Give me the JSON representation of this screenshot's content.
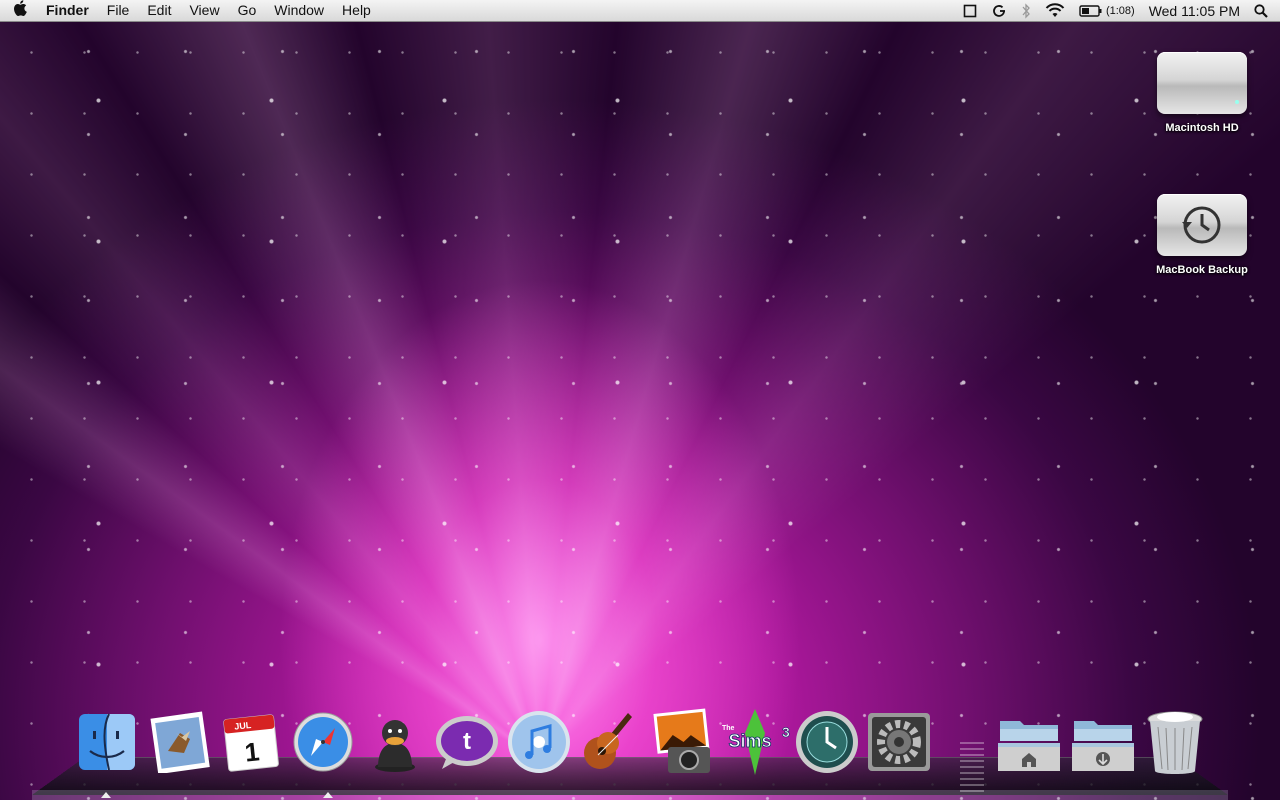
{
  "menubar": {
    "apple_icon": "apple-icon",
    "app_name": "Finder",
    "menus": [
      "File",
      "Edit",
      "View",
      "Go",
      "Window",
      "Help"
    ],
    "status": {
      "battery_time": "(1:08)",
      "clock": "Wed 11:05 PM",
      "icons": [
        "display-icon",
        "sync-icon",
        "bluetooth-icon",
        "wifi-icon",
        "battery-icon",
        "spotlight-icon"
      ]
    }
  },
  "desktop": {
    "icons": [
      {
        "label": "Macintosh HD",
        "icon": "hard-drive-icon"
      },
      {
        "label": "MacBook Backup",
        "icon": "time-machine-drive-icon"
      }
    ]
  },
  "dock": {
    "items": [
      "finder-icon",
      "mail-icon",
      "ical-icon",
      "safari-icon",
      "adium-icon",
      "twitter-icon",
      "itunes-icon",
      "garageband-icon",
      "iphoto-icon",
      "sims3-icon",
      "time-machine-icon",
      "system-preferences-icon",
      "applications-folder-icon",
      "downloads-folder-icon",
      "trash-icon"
    ],
    "calendar": {
      "month": "JUL",
      "day": "1"
    },
    "sims_label": "Sims",
    "sims_small": "The",
    "sims_num": "3",
    "colors": {
      "finder": "#3a8ee6",
      "twitter": "#7b2bb0",
      "itunes": "#2e7de0"
    }
  }
}
